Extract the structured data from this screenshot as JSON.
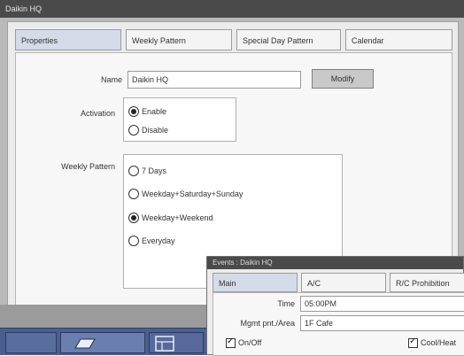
{
  "window": {
    "title": "Daikin HQ"
  },
  "tabs": [
    "Properties",
    "Weekly Pattern",
    "Special Day Pattern",
    "Calendar"
  ],
  "properties": {
    "name_label": "Name",
    "name_value": "Daikin HQ",
    "modify_label": "Modify",
    "activation_label": "Activation",
    "activation_options": [
      "Enable",
      "Disable"
    ],
    "activation_selected": "Enable",
    "weekly_pattern_label": "Weekly Pattern",
    "weekly_pattern_options": [
      "7 Days",
      "Weekday+Saturday+Sunday",
      "Weekday+Weekend",
      "Everyday"
    ],
    "weekly_pattern_selected": "Weekday+Weekend"
  },
  "event_dialog": {
    "title": "Events : Daikin HQ",
    "tabs": [
      "Main",
      "A/C",
      "R/C Prohibition"
    ],
    "time_label": "Time",
    "time_value": "05:00PM",
    "area_label": "Mgmt pnt./Area",
    "area_value": "1F Cafe",
    "checkbox_1": "On/Off",
    "checkbox_2": "Cool/Heat"
  },
  "icons": [
    "dialog-icon",
    "grid-icon"
  ]
}
